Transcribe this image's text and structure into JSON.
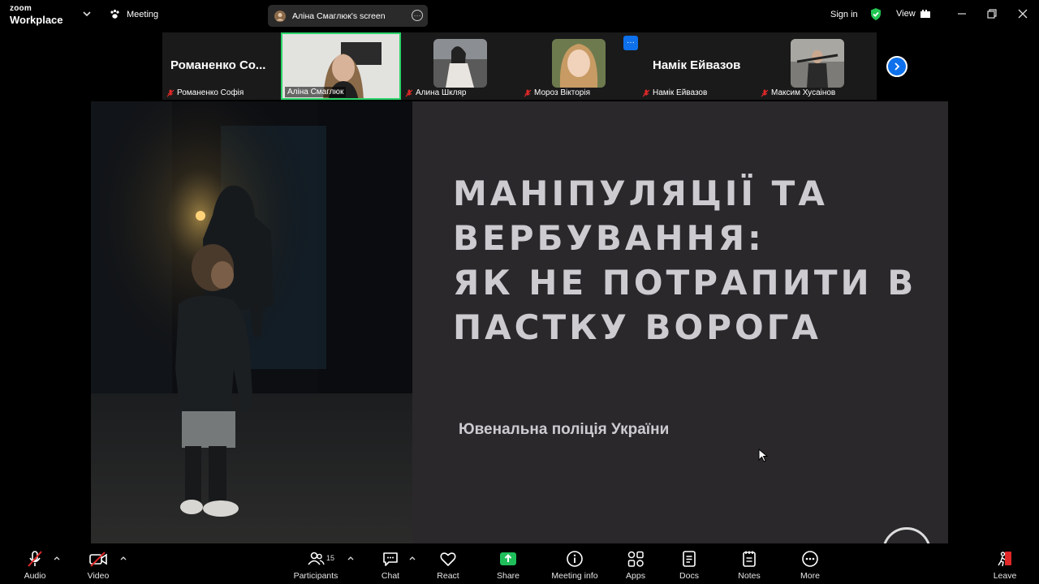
{
  "app": {
    "logo_small": "zoom",
    "logo_big": "Workplace"
  },
  "topbar": {
    "meeting_label": "Meeting",
    "share_indicator": "Аліна Смаглюк's screen",
    "sign_in": "Sign in",
    "view_label": "View"
  },
  "participants_strip": [
    {
      "big_name": "Романенко Со...",
      "caption": "Романенко Софія",
      "muted": true
    },
    {
      "caption": "Аліна Смаглюк",
      "muted": false,
      "active_speaker": true
    },
    {
      "caption": "Алина Шкляр",
      "muted": true
    },
    {
      "caption": "Мороз Вікторія",
      "muted": true
    },
    {
      "big_name": "Намік Ейвазов",
      "caption": "Намік Ейвазов",
      "muted": true
    },
    {
      "caption": "Максим Хусаінов",
      "muted": true
    }
  ],
  "slide": {
    "title_lines": [
      "МАНІПУЛЯЦІЇ ТА",
      "ВЕРБУВАННЯ:",
      "ЯК НЕ ПОТРАПИТИ В",
      "ПАСТКУ ВОРОГА"
    ],
    "subtitle": "Ювенальна поліція України"
  },
  "toolbar": {
    "audio": "Audio",
    "video": "Video",
    "participants": "Participants",
    "participants_count": "15",
    "chat": "Chat",
    "react": "React",
    "share": "Share",
    "meeting_info": "Meeting info",
    "apps": "Apps",
    "docs": "Docs",
    "notes": "Notes",
    "more": "More",
    "leave": "Leave"
  },
  "colors": {
    "accent_blue": "#0e71eb",
    "active_green": "#2bd46a",
    "mute_red": "#e02828",
    "share_green": "#1fbe5b"
  }
}
